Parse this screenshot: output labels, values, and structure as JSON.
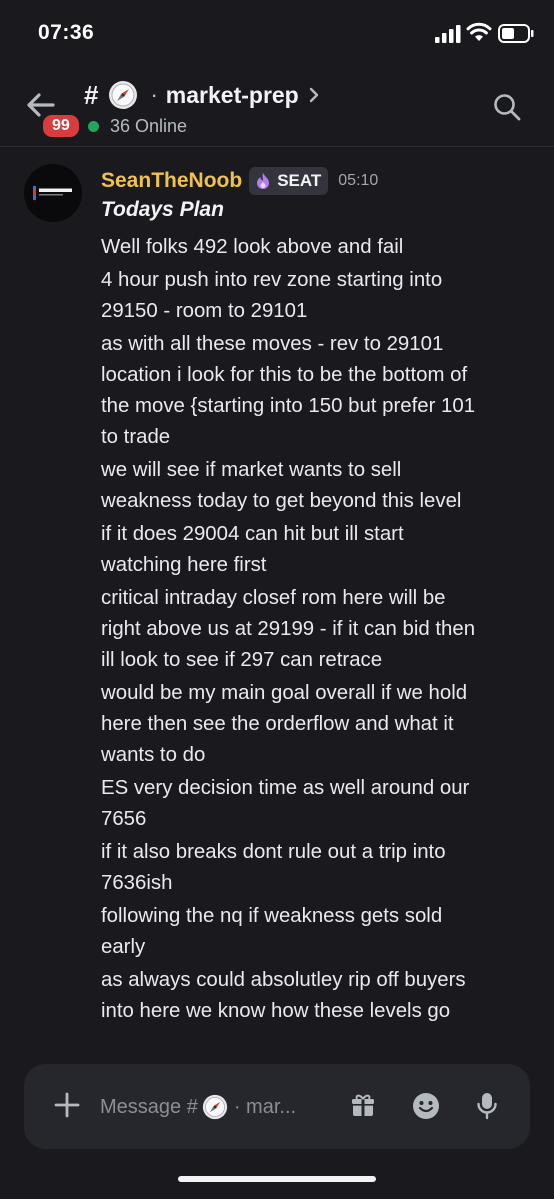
{
  "status_bar": {
    "time": "07:36"
  },
  "header": {
    "unread_badge": "99",
    "hash": "#",
    "separator": "·",
    "channel_name": "market-prep",
    "online_count": "36 Online"
  },
  "message": {
    "username": "SeanTheNoob",
    "role_tag": "SEAT",
    "timestamp": "05:10",
    "title": "Todays Plan",
    "lines": [
      "Well folks 492 look above and fail",
      "4 hour push into rev zone starting into",
      "29150 - room to 29101",
      "as with all these moves - rev to 29101",
      "location i look for this to be the bottom of",
      "the move {starting into 150 but prefer 101",
      "to trade",
      "we will see if market wants to sell",
      "weakness today to get beyond this level",
      "if it does 29004 can hit but ill start",
      "watching here first",
      "critical intraday closef rom here will be",
      "right above us at 29199 - if it can bid then",
      "ill look to see if 297 can retrace",
      "would be my main goal overall if we hold",
      "here then see the orderflow and what it",
      "wants to do",
      "ES very decision time as well around our",
      "7656",
      "if it also breaks dont rule out a trip into",
      "7636ish",
      "following the nq if weakness gets sold",
      "early",
      "as always could absolutley rip off buyers",
      "into here we know how these levels go"
    ]
  },
  "input": {
    "placeholder_prefix": "Message #",
    "placeholder_suffix": "· mar..."
  },
  "icons": {
    "back": "arrow-left-icon",
    "search": "search-icon",
    "plus": "plus-icon",
    "gift": "gift-icon",
    "emoji": "emoji-icon",
    "mic": "mic-icon",
    "compass": "compass-icon"
  },
  "colors": {
    "background": "#1a1a1e",
    "username": "#f0c24b",
    "online": "#23a55a",
    "badge": "#d83c3e",
    "input_bar": "#26272c"
  }
}
